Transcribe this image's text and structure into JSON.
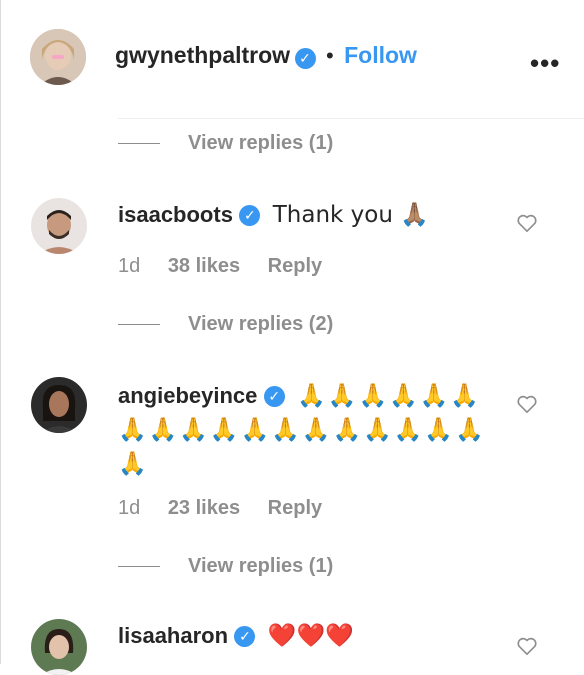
{
  "post_header": {
    "username": "gwynethpaltrow",
    "verified_icon": "verified-badge-icon",
    "separator": "•",
    "follow_label": "Follow",
    "more_icon": "•••"
  },
  "thread": [
    {
      "type": "replies",
      "label": "View replies (1)"
    },
    {
      "type": "comment",
      "username": "isaacboots",
      "text": "Thank you 🙏🏽",
      "age": "1d",
      "likes": "38 likes",
      "reply": "Reply"
    },
    {
      "type": "replies",
      "label": "View replies (2)"
    },
    {
      "type": "comment",
      "username": "angiebeyince",
      "text": "🙏🙏🙏🙏🙏🙏🙏🙏🙏🙏🙏🙏🙏🙏🙏🙏🙏🙏🙏",
      "age": "1d",
      "likes": "23 likes",
      "reply": "Reply"
    },
    {
      "type": "replies",
      "label": "View replies (1)"
    },
    {
      "type": "comment",
      "username": "lisaaharon",
      "text": "❤️❤️❤️"
    }
  ],
  "colors": {
    "link": "#3897f0",
    "muted": "#8e8e8e",
    "text": "#262626"
  }
}
